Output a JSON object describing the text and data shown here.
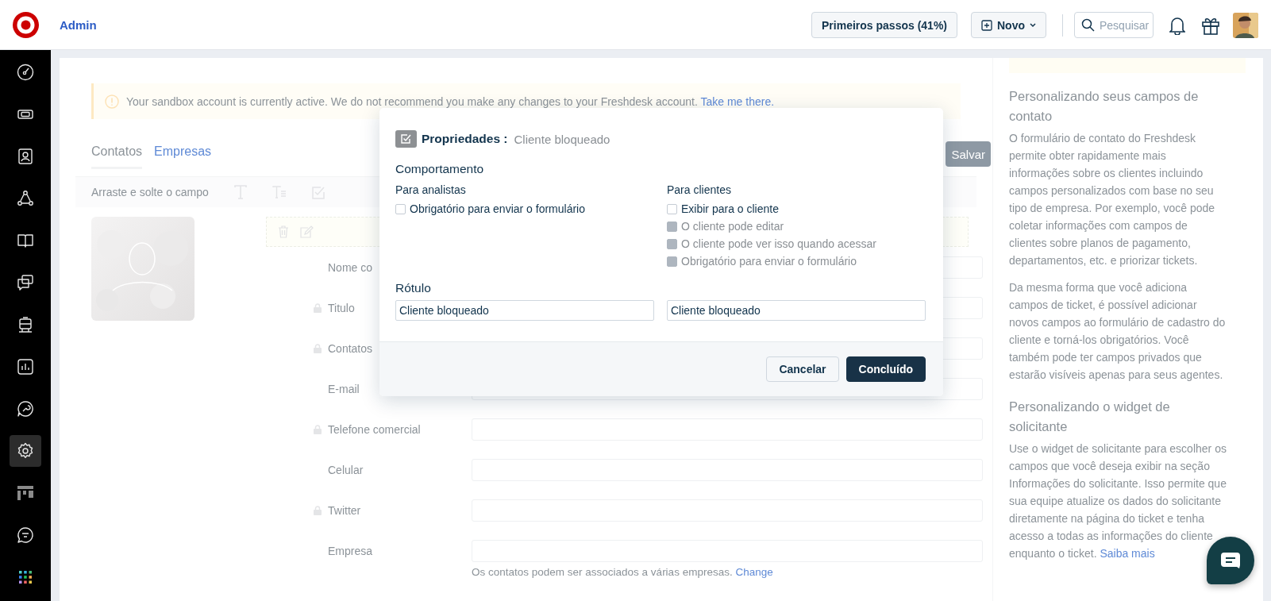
{
  "topbar": {
    "title": "Admin",
    "getting_started": "Primeiros passos (41%)",
    "new_button": "Novo",
    "search": {
      "placeholder": "Pesquisar"
    }
  },
  "sidebar": {
    "items": [
      {
        "selected": false
      },
      {
        "selected": false
      },
      {
        "selected": false
      },
      {
        "selected": false
      },
      {
        "selected": false
      },
      {
        "selected": false
      },
      {
        "selected": false
      },
      {
        "selected": false
      },
      {
        "selected": false
      },
      {
        "selected": true
      },
      {
        "selected": false
      },
      {
        "selected": false
      },
      {
        "selected": false
      }
    ]
  },
  "banner": {
    "text": "Your sandbox account is currently active. We do not recommend you make any changes to your Freshdesk account.",
    "link": "Take me there."
  },
  "tabs": [
    {
      "label": "Contatos",
      "selected": true
    },
    {
      "label": "Empresas",
      "selected": false
    }
  ],
  "save_button": "Salvar",
  "toolbar": {
    "hint": "Arraste e solte o campo"
  },
  "form": {
    "fields": [
      {
        "label": "Nome co",
        "locked": false
      },
      {
        "label": "Titulo",
        "locked": true
      },
      {
        "label": "Contatos",
        "locked": true
      },
      {
        "label": "E-mail",
        "locked": false
      },
      {
        "label": "Telefone comercial",
        "locked": true
      },
      {
        "label": "Celular",
        "locked": false
      },
      {
        "label": "Twitter",
        "locked": true
      },
      {
        "label": "Empresa",
        "locked": false
      }
    ],
    "note": "Os contatos podem ser associados a várias empresas.",
    "note_link": "Change"
  },
  "help": [
    {
      "heading": "Personalizando seus campos de contato",
      "paragraphs": [
        {
          "text": "O formulário de contato do Freshdesk permite obter rapidamente mais informações sobre os clientes incluindo campos personalizados com base no seu tipo de empresa. Por exemplo, você pode coletar informações com campos de clientes sobre planos de pagamento, departamentos, etc. e priorizar tickets."
        },
        {
          "text": "Da mesma forma que você adiciona campos de ticket, é possível adicionar novos campos ao formulário de cadastro do cliente e torná-los obrigatórios. Você também pode ter campos privados que estarão visíveis apenas para seus agentes."
        }
      ]
    },
    {
      "heading": "Personalizando o widget de solicitante",
      "paragraphs": [
        {
          "text": "Use o widget de solicitante para escolher os campos que você deseja exibir na seção Informações do solicitante. Isso permite que sua equipe atualize os dados do solicitante diretamente na página do ticket e tenha acesso a todas as informações do cliente enquanto o ticket.",
          "link": "Saiba mais"
        }
      ]
    }
  ],
  "modal": {
    "title": "Propriedades :",
    "field_name": "Cliente bloqueado",
    "section": "Comportamento",
    "agents": {
      "heading": "Para analistas",
      "options": [
        {
          "label": "Obrigatório para enviar o formulário",
          "checked": false,
          "disabled": false
        }
      ]
    },
    "customers": {
      "heading": "Para clientes",
      "options": [
        {
          "label": "Exibir para o cliente",
          "checked": false,
          "disabled": false
        },
        {
          "label": "O cliente pode editar",
          "checked": false,
          "disabled": true
        },
        {
          "label": "O cliente pode ver isso quando acessar",
          "checked": false,
          "disabled": true
        },
        {
          "label": "Obrigatório para enviar o formulário",
          "checked": false,
          "disabled": true
        }
      ]
    },
    "label_section": "Rótulo",
    "agent_label": {
      "value": "Cliente bloqueado"
    },
    "customer_label": {
      "value": "Cliente bloqueado"
    },
    "buttons": [
      {
        "label": "Cancelar",
        "kind": "secondary"
      },
      {
        "label": "Concluído",
        "kind": "primary"
      }
    ]
  }
}
